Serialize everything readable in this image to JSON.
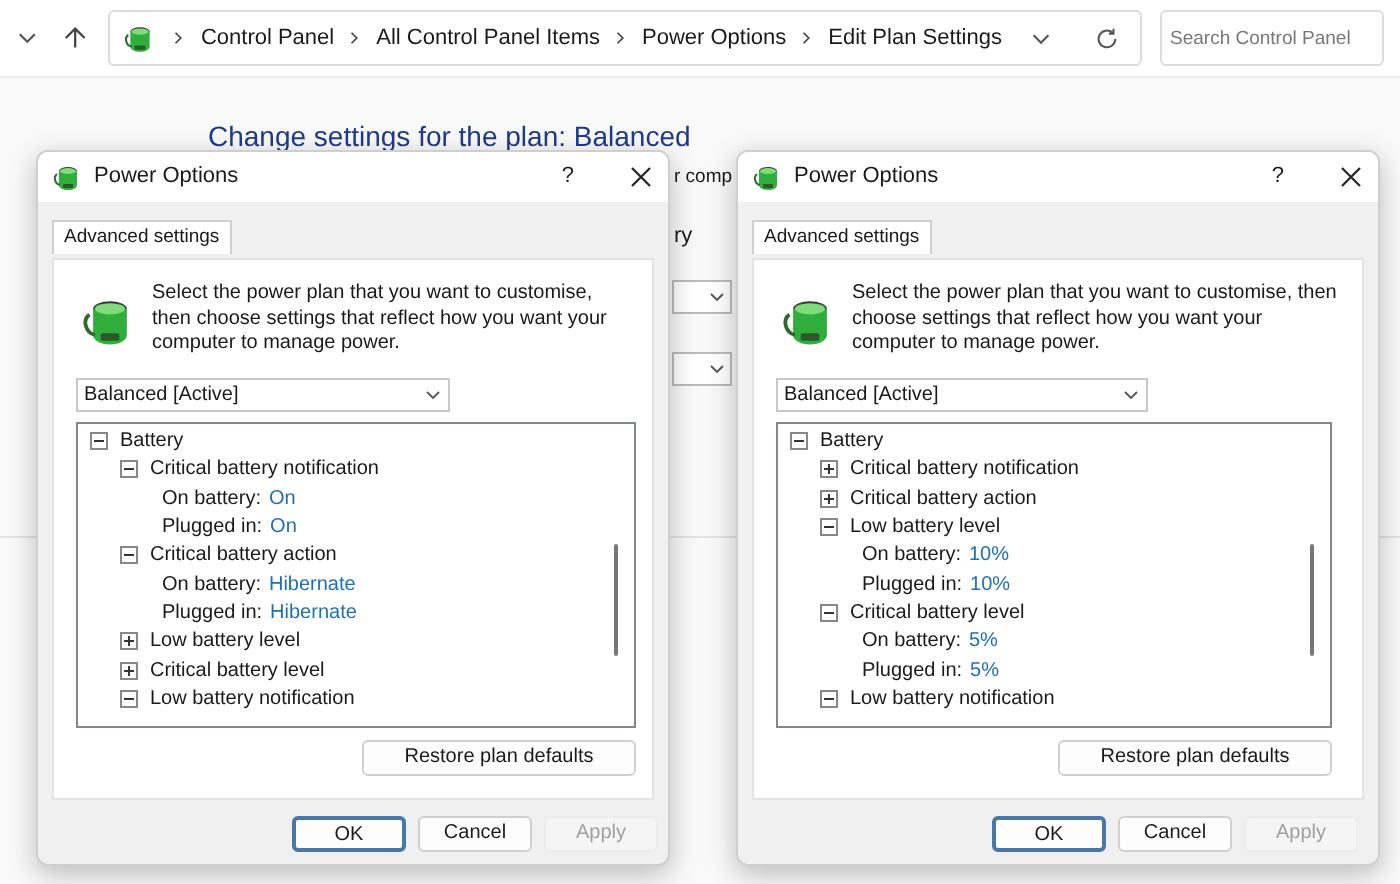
{
  "address_bar": {
    "path": [
      "Control Panel",
      "All Control Panel Items",
      "Power Options",
      "Edit Plan Settings"
    ]
  },
  "search": {
    "placeholder": "Search Control Panel"
  },
  "page": {
    "heading": "Change settings for the plan: Balanced",
    "fragments": [
      "r comp",
      "ry"
    ]
  },
  "dialogs": [
    {
      "title": "Power Options",
      "help": "?",
      "tab": {
        "label": "Advanced settings",
        "selected": true
      },
      "description": "Select the power plan that you want to customise, then choose settings that reflect how you want your computer to manage power.",
      "plan": "Balanced [Active]",
      "tree": [
        {
          "kind": "group",
          "label": "Battery",
          "expanded": true,
          "children": [
            {
              "kind": "group",
              "label": "Critical battery notification",
              "expanded": true,
              "children": [
                {
                  "kind": "setting",
                  "label": "On battery:",
                  "value": "On"
                },
                {
                  "kind": "setting",
                  "label": "Plugged in:",
                  "value": "On"
                }
              ]
            },
            {
              "kind": "group",
              "label": "Critical battery action",
              "expanded": true,
              "children": [
                {
                  "kind": "setting",
                  "label": "On battery:",
                  "value": "Hibernate"
                },
                {
                  "kind": "setting",
                  "label": "Plugged in:",
                  "value": "Hibernate"
                }
              ]
            },
            {
              "kind": "group",
              "label": "Low battery level",
              "expanded": false
            },
            {
              "kind": "group",
              "label": "Critical battery level",
              "expanded": false
            },
            {
              "kind": "group",
              "label": "Low battery notification",
              "expanded": true
            }
          ]
        }
      ],
      "restore": "Restore plan defaults",
      "buttons": [
        {
          "label": "OK",
          "default": true,
          "disabled": false
        },
        {
          "label": "Cancel",
          "default": false,
          "disabled": false
        },
        {
          "label": "Apply",
          "default": false,
          "disabled": true
        }
      ]
    },
    {
      "title": "Power Options",
      "help": "?",
      "tab": {
        "label": "Advanced settings",
        "selected": true
      },
      "description": "Select the power plan that you want to customise, then choose settings that reflect how you want your computer to manage power.",
      "plan": "Balanced [Active]",
      "tree": [
        {
          "kind": "group",
          "label": "Battery",
          "expanded": true,
          "children": [
            {
              "kind": "group",
              "label": "Critical battery notification",
              "expanded": false
            },
            {
              "kind": "group",
              "label": "Critical battery action",
              "expanded": false
            },
            {
              "kind": "group",
              "label": "Low battery level",
              "expanded": true,
              "children": [
                {
                  "kind": "setting",
                  "label": "On battery:",
                  "value": "10%"
                },
                {
                  "kind": "setting",
                  "label": "Plugged in:",
                  "value": "10%"
                }
              ]
            },
            {
              "kind": "group",
              "label": "Critical battery level",
              "expanded": true,
              "children": [
                {
                  "kind": "setting",
                  "label": "On battery:",
                  "value": "5%"
                },
                {
                  "kind": "setting",
                  "label": "Plugged in:",
                  "value": "5%"
                }
              ]
            },
            {
              "kind": "group",
              "label": "Low battery notification",
              "expanded": true
            }
          ]
        }
      ],
      "restore": "Restore plan defaults",
      "buttons": [
        {
          "label": "OK",
          "default": true,
          "disabled": false
        },
        {
          "label": "Cancel",
          "default": false,
          "disabled": false
        },
        {
          "label": "Apply",
          "default": false,
          "disabled": true
        }
      ]
    }
  ]
}
